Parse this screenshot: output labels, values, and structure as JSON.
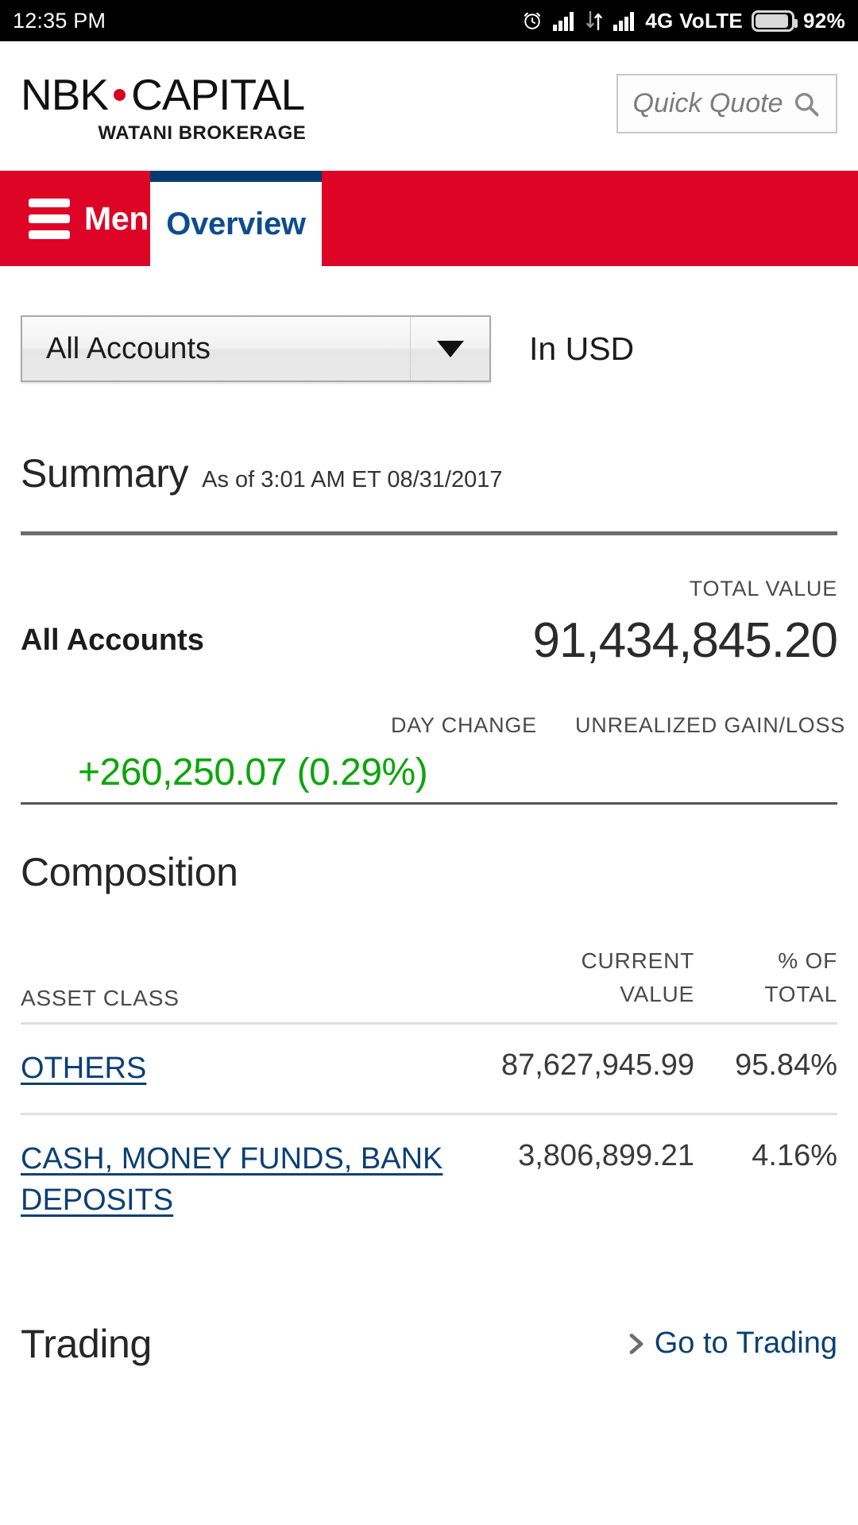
{
  "statusbar": {
    "time": "12:35 PM",
    "network": "4G VoLTE",
    "battery": "92%",
    "icons": [
      "alarm-clock-icon",
      "signal-bars-icon",
      "data-transfer-icon",
      "signal-bars-icon",
      "battery-icon"
    ]
  },
  "header": {
    "brand_part1": "NBK",
    "brand_part2": "CAPITAL",
    "brand_subtitle": "WATANI BROKERAGE",
    "quick_quote_placeholder": "Quick Quote"
  },
  "nav": {
    "menu_label": "Menu",
    "active_tab": "Overview"
  },
  "controls": {
    "account_selected": "All Accounts",
    "currency_label": "In USD"
  },
  "summary": {
    "title": "Summary",
    "as_of": "As of 3:01 AM ET 08/31/2017",
    "total_value_label": "TOTAL VALUE",
    "account_name": "All Accounts",
    "total_value": "91,434,845.20",
    "day_change_label": "DAY CHANGE",
    "unrealized_label": "UNREALIZED GAIN/LOSS",
    "day_change_value": "+260,250.07 (0.29%)",
    "unrealized_value": "",
    "positive_color": "#0aa60a"
  },
  "composition": {
    "title": "Composition",
    "columns": {
      "asset_class": "ASSET CLASS",
      "current_value_line1": "CURRENT",
      "current_value_line2": "VALUE",
      "pct_total_line1": "% OF",
      "pct_total_line2": "TOTAL"
    },
    "rows": [
      {
        "asset_class": "OTHERS",
        "current_value": "87,627,945.99",
        "pct_total": "95.84%"
      },
      {
        "asset_class": "CASH, MONEY FUNDS, BANK DEPOSITS",
        "current_value": "3,806,899.21",
        "pct_total": "4.16%"
      }
    ]
  },
  "trading": {
    "title": "Trading",
    "go_to_trading": "Go to Trading"
  },
  "theme": {
    "brand_red": "#dd0425",
    "brand_navy": "#003a70",
    "link_navy": "#0b3f75",
    "tab_text": "#0b4d8f"
  }
}
